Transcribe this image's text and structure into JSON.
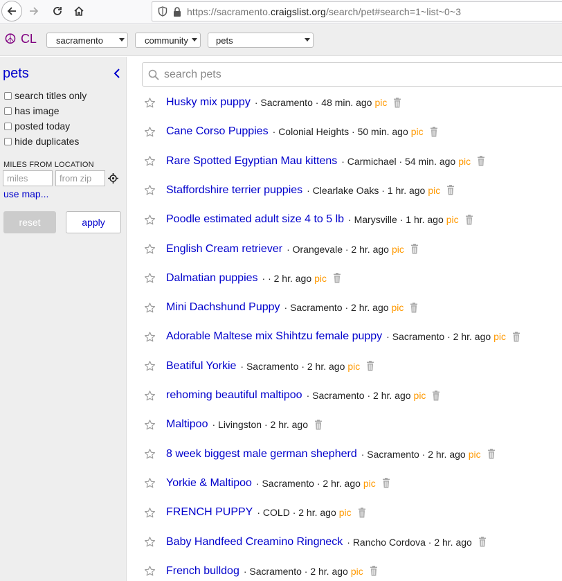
{
  "browser": {
    "url_prefix": "https://sacramento.",
    "url_domain": "craigslist.org",
    "url_suffix": "/search/pet#search=1~list~0~3"
  },
  "header": {
    "logo_text": "CL",
    "area_select": "sacramento",
    "category_select": "community",
    "subcategory_select": "pets"
  },
  "sidebar": {
    "title": "pets",
    "filters": [
      {
        "label": "search titles only"
      },
      {
        "label": "has image"
      },
      {
        "label": "posted today"
      },
      {
        "label": "hide duplicates"
      }
    ],
    "miles_label": "MILES FROM LOCATION",
    "miles_placeholder": "miles",
    "zip_placeholder": "from zip",
    "use_map": "use map...",
    "reset_label": "reset",
    "apply_label": "apply"
  },
  "search": {
    "placeholder": "search pets"
  },
  "results": [
    {
      "title": "Husky mix puppy",
      "meta": "· Sacramento · 48 min. ago",
      "pic": "pic"
    },
    {
      "title": "Cane Corso Puppies",
      "meta": "· Colonial Heights · 50 min. ago",
      "pic": "pic"
    },
    {
      "title": "Rare Spotted Egyptian Mau kittens",
      "meta": "· Carmichael · 54 min. ago",
      "pic": "pic"
    },
    {
      "title": "Staffordshire terrier puppies",
      "meta": "· Clearlake Oaks · 1 hr. ago",
      "pic": "pic"
    },
    {
      "title": "Poodle estimated adult size 4 to 5 lb",
      "meta": "· Marysville · 1 hr. ago",
      "pic": "pic"
    },
    {
      "title": "English Cream retriever",
      "meta": "· Orangevale · 2 hr. ago",
      "pic": "pic"
    },
    {
      "title": "Dalmatian puppies",
      "meta": "· · 2 hr. ago",
      "pic": "pic"
    },
    {
      "title": "Mini Dachshund Puppy",
      "meta": "· Sacramento · 2 hr. ago",
      "pic": "pic"
    },
    {
      "title": "Adorable Maltese mix Shihtzu female puppy",
      "meta": "· Sacramento · 2 hr. ago",
      "pic": "pic"
    },
    {
      "title": "Beatiful Yorkie",
      "meta": "· Sacramento · 2 hr. ago",
      "pic": "pic"
    },
    {
      "title": "rehoming beautiful maltipoo",
      "meta": "· Sacramento · 2 hr. ago",
      "pic": "pic"
    },
    {
      "title": "Maltipoo",
      "meta": "· Livingston · 2 hr. ago",
      "pic": ""
    },
    {
      "title": "8 week biggest male german shepherd",
      "meta": "· Sacramento · 2 hr. ago",
      "pic": "pic"
    },
    {
      "title": "Yorkie & Maltipoo",
      "meta": "· Sacramento · 2 hr. ago",
      "pic": "pic"
    },
    {
      "title": "FRENCH PUPPY",
      "meta": "· COLD · 2 hr. ago",
      "pic": "pic"
    },
    {
      "title": "Baby Handfeed Creamino Ringneck",
      "meta": "· Rancho Cordova · 2 hr. ago",
      "pic": ""
    },
    {
      "title": "French bulldog",
      "meta": "· Sacramento · 2 hr. ago",
      "pic": "pic"
    }
  ],
  "icons": {
    "star": "star-icon",
    "trash": "trash-icon"
  },
  "colors": {
    "link": "#0000cc",
    "pic": "#ff9900",
    "logo": "#800080"
  }
}
